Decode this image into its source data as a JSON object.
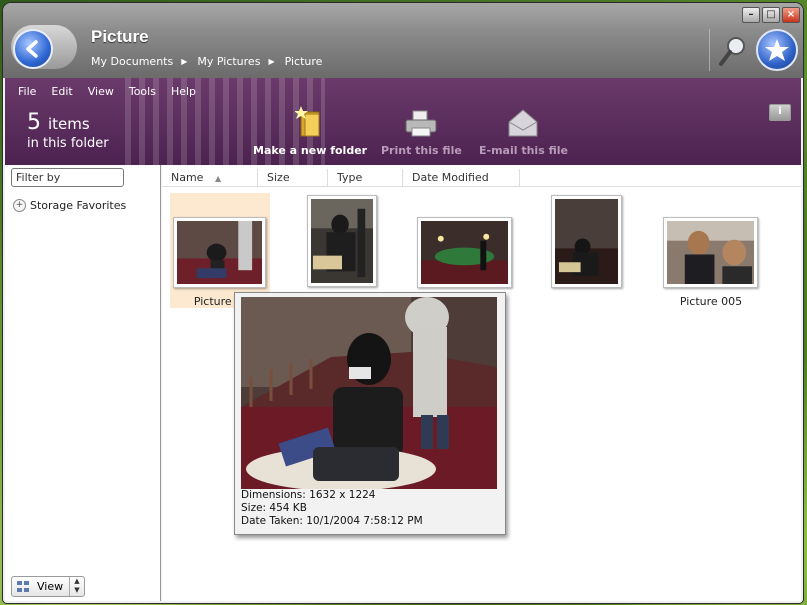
{
  "window": {
    "title": "Picture",
    "breadcrumbs": [
      "My Documents",
      "My Pictures",
      "Picture"
    ]
  },
  "menu": [
    "File",
    "Edit",
    "Tools",
    "Help",
    "View"
  ],
  "menubar": {
    "file": "File",
    "edit": "Edit",
    "view": "View",
    "tools": "Tools",
    "help": "Help"
  },
  "folder_info": {
    "count": "5",
    "items_word": "items",
    "subtitle": "in this folder"
  },
  "toolbar": {
    "new_folder": "Make a new folder",
    "print": "Print this file",
    "email": "E-mail this file"
  },
  "sidebar": {
    "filter_placeholder": "Filter by",
    "favorites": "Storage Favorites",
    "view_label": "View"
  },
  "columns": [
    "Name",
    "Size",
    "Type",
    "Date Modified"
  ],
  "files": [
    {
      "caption": "Picture 0"
    },
    {
      "caption": ""
    },
    {
      "caption": ""
    },
    {
      "caption": ""
    },
    {
      "caption": "Picture 005"
    }
  ],
  "tooltip": {
    "dimensions": "Dimensions: 1632 x 1224",
    "size": "Size: 454 KB",
    "date_taken": "Date Taken: 10/1/2004 7:58:12 PM"
  },
  "colors": {
    "toolbar": "#4c2250",
    "selection": "#fde9d0",
    "accent": "#2f67d3"
  }
}
